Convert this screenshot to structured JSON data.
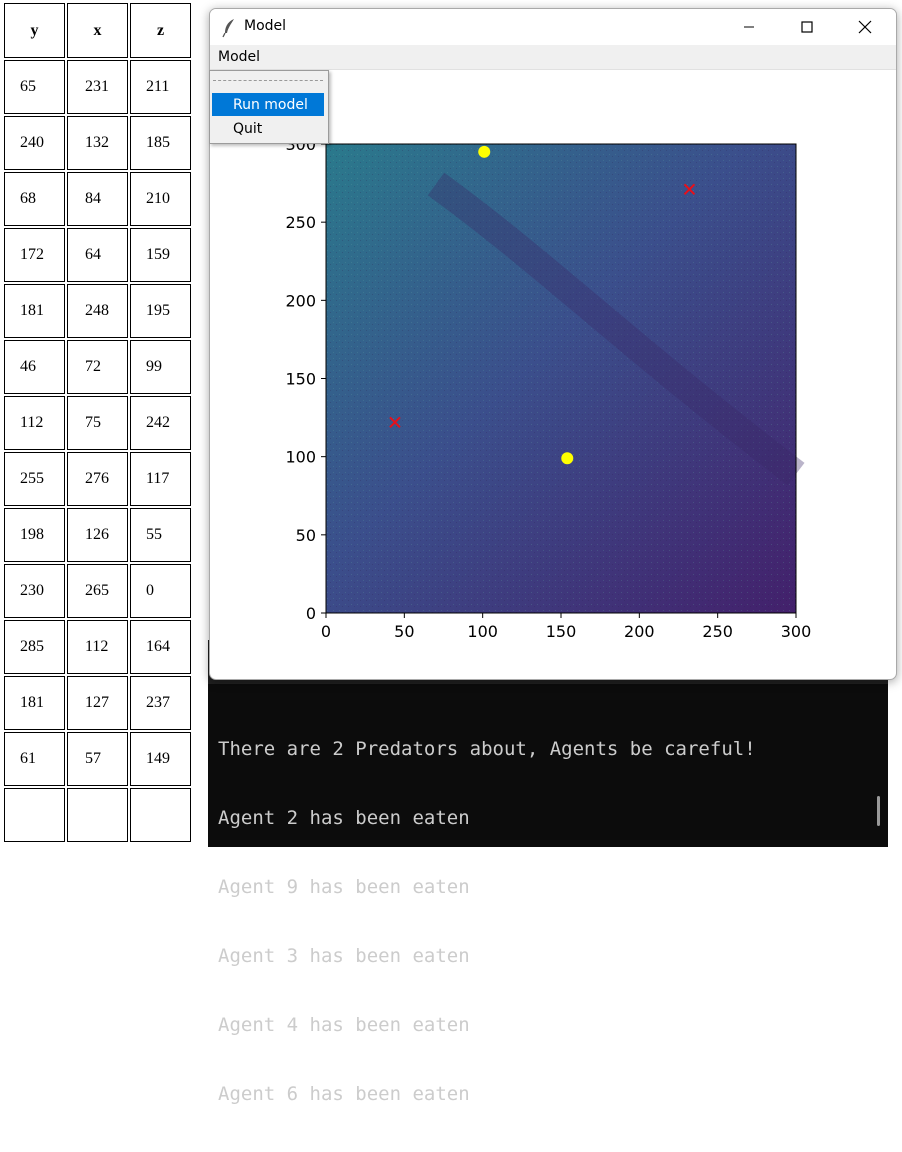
{
  "table": {
    "headers": [
      "y",
      "x",
      "z"
    ],
    "rows": [
      [
        "65",
        "231",
        "211"
      ],
      [
        "240",
        "132",
        "185"
      ],
      [
        "68",
        "84",
        "210"
      ],
      [
        "172",
        "64",
        "159"
      ],
      [
        "181",
        "248",
        "195"
      ],
      [
        "46",
        "72",
        "99"
      ],
      [
        "112",
        "75",
        "242"
      ],
      [
        "255",
        "276",
        "117"
      ],
      [
        "198",
        "126",
        "55"
      ],
      [
        "230",
        "265",
        "0"
      ],
      [
        "285",
        "112",
        "164"
      ],
      [
        "181",
        "127",
        "237"
      ],
      [
        "61",
        "57",
        "149"
      ]
    ]
  },
  "window": {
    "title": "Model",
    "icon": "feather-icon",
    "controls": [
      "minimize-icon",
      "maximize-icon",
      "close-icon"
    ],
    "menu": "Model"
  },
  "dropdown": {
    "items": [
      "Run model",
      "Quit"
    ],
    "selected": "Run model"
  },
  "terminal": {
    "lines": [
      "There are 2 Predators about, Agents be careful!",
      "Agent 2 has been eaten",
      "Agent 9 has been eaten",
      "Agent 3 has been eaten",
      "Agent 4 has been eaten",
      "Agent 6 has been eaten"
    ]
  },
  "chart_data": {
    "type": "scatter",
    "background": "heatmap (environment raster, viridis-like colormap)",
    "xlim": [
      0,
      300
    ],
    "ylim": [
      0,
      300
    ],
    "xticks": [
      "0",
      "50",
      "100",
      "150",
      "200",
      "250",
      "300"
    ],
    "yticks": [
      "0",
      "50",
      "100",
      "150",
      "200",
      "250",
      "300"
    ],
    "series": [
      {
        "marker": "circle",
        "color": "#ffff00",
        "points": [
          [
            101,
            295
          ],
          [
            154,
            99
          ]
        ]
      },
      {
        "marker": "x",
        "color": "#e8101a",
        "points": [
          [
            232,
            271
          ],
          [
            44,
            122
          ]
        ]
      }
    ],
    "colors": {
      "low": "#43206b",
      "mid": "#3b4f8c",
      "high": "#2a7a8c"
    }
  }
}
